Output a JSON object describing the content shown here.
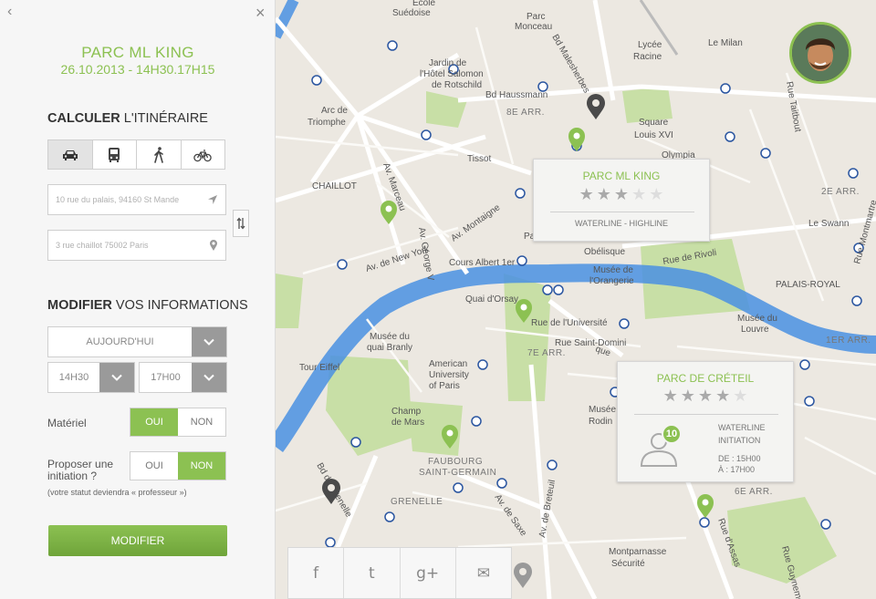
{
  "nav": {
    "back": "‹",
    "close": "×"
  },
  "event": {
    "title": "PARC ML KING",
    "datetime": "26.10.2013 - 14H30.17H15"
  },
  "route": {
    "title_bold": "CALCULER",
    "title_rest": " L'ITINÉRAIRE",
    "modes": [
      "car-icon",
      "bus-icon",
      "walk-icon",
      "bike-icon"
    ],
    "active_mode": 0,
    "from_placeholder": "10 rue du palais, 94160 St Mande",
    "to_placeholder": "3 rue chaillot 75002 Paris"
  },
  "info": {
    "title_bold": "MODIFIER",
    "title_rest": " VOS INFORMATIONS",
    "day": "AUJOURD'HUI",
    "start": "14H30",
    "end": "17H00",
    "materiel_label": "Matériel",
    "initiation_label_1": "Proposer une",
    "initiation_label_2": "initiation ?",
    "note": "(votre statut deviendra « professeur »)",
    "yes": "OUI",
    "no": "NON",
    "submit": "MODIFIER"
  },
  "popups": {
    "mlking": {
      "title": "PARC ML KING",
      "rating": 3,
      "subtitle": "WATERLINE - HIGHLINE"
    },
    "creteil": {
      "title": "PARC DE CRÉTEIL",
      "rating": 4,
      "count": "10",
      "line1": "WATERLINE",
      "line2": "INITIATION",
      "from": "DE :   15H00",
      "to": "À :     17H00"
    }
  },
  "share": [
    "f",
    "t",
    "g+",
    "✉"
  ],
  "colors": {
    "accent": "#8cc152",
    "river": "#4a90e2",
    "park": "#c8dfa6"
  }
}
